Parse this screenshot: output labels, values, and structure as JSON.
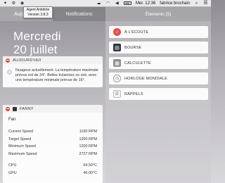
{
  "menubar": {
    "clock": "Mer. 12:36",
    "user": "fabrice brochain",
    "icons": [
      "dropbox-icon",
      "gear-icon",
      "wifi-icon",
      "volume-icon",
      "battery-icon",
      "search-icon",
      "list-icon"
    ]
  },
  "tooltip": {
    "line1": "Agent Antidote",
    "line2": "Version 3.8.3"
  },
  "tabs": [
    {
      "label": "Aujourd'hui",
      "active": true
    },
    {
      "label": "Notifications",
      "active": false
    }
  ],
  "right_panel": {
    "title": "Éléments (5)",
    "widgets": [
      {
        "label": "À L'ÉCOUTE",
        "icon": "music-icon"
      },
      {
        "label": "BOURSE",
        "icon": "stocks-icon"
      },
      {
        "label": "CALCULETTE",
        "icon": "calculator-icon"
      },
      {
        "label": "HORLOGE MONDIALE",
        "icon": "clock-icon"
      },
      {
        "label": "RAPPELS",
        "icon": "reminders-icon"
      }
    ]
  },
  "date": {
    "weekday": "Mercredi",
    "day": "20 juillet"
  },
  "today_section": {
    "header": "AUJOURD'HUI",
    "text": "Nuageux actuellement. La température maximale prévue est de 24°. Belles éclaircies ce soir, avec une température minimale prévue de 16°."
  },
  "fanny_section": {
    "header": "FANNY",
    "title": "Fan",
    "rows": [
      {
        "label": "Current Speed",
        "value": "1190 RPM"
      },
      {
        "label": "Target Speed",
        "value": "1200 RPM"
      },
      {
        "label": "Minimum Speed",
        "value": "1200 RPM"
      },
      {
        "label": "Maximum Speed",
        "value": "2727 RPM"
      }
    ],
    "temps": [
      {
        "label": "CPU",
        "value": "64.50°C"
      },
      {
        "label": "GPU",
        "value": "46.00°C"
      }
    ]
  }
}
